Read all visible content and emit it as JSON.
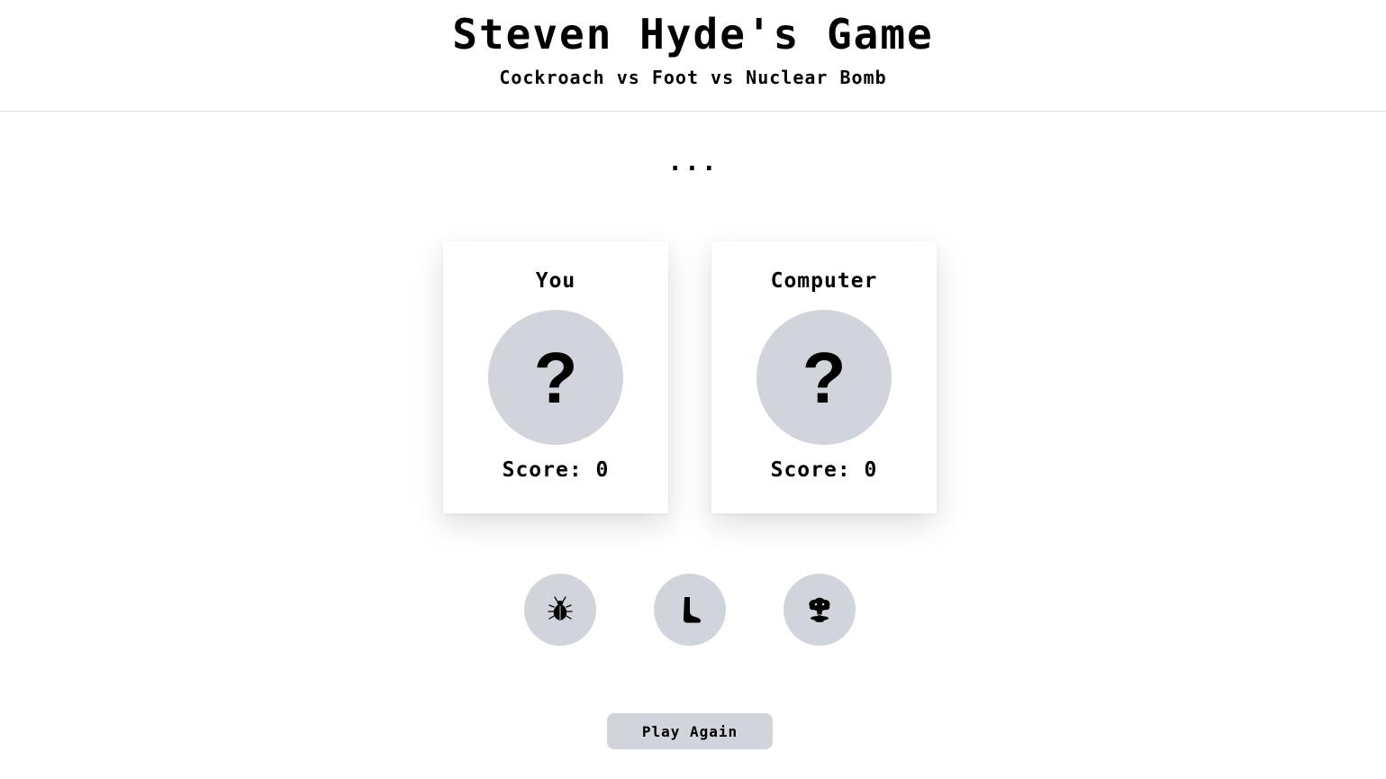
{
  "header": {
    "title": "Steven Hyde's Game",
    "subtitle": "Cockroach vs Foot vs Nuclear Bomb"
  },
  "status": "...",
  "players": [
    {
      "name": "You",
      "choice": "?",
      "score_text": "Score: 0",
      "score": 0
    },
    {
      "name": "Computer",
      "choice": "?",
      "score_text": "Score: 0",
      "score": 0
    }
  ],
  "choices": [
    {
      "id": "cockroach",
      "icon": "cockroach-icon"
    },
    {
      "id": "foot",
      "icon": "foot-icon"
    },
    {
      "id": "nuclear-bomb",
      "icon": "nuclear-bomb-icon"
    }
  ],
  "actions": {
    "play_again_label": "Play Again"
  },
  "colors": {
    "background": "#ffffff",
    "circle_fill": "#d1d4da",
    "text": "#000000",
    "divider": "#e2e2e2"
  }
}
